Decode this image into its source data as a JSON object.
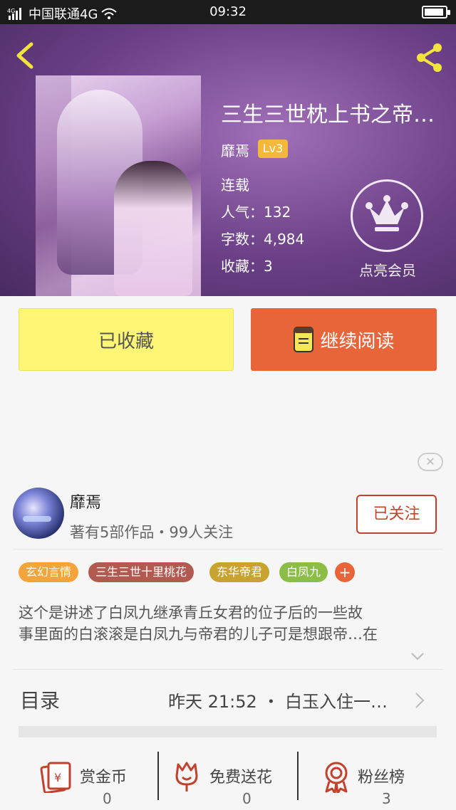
{
  "status_bar": {
    "carrier": "中国联通4G",
    "signal_label": "4G",
    "time": "09:32"
  },
  "book": {
    "title": "三生三世枕上书之帝…",
    "author": "靡焉",
    "level": "Lv3",
    "status": "连载",
    "popularity_label": "人气：",
    "popularity": "132",
    "words_label": "字数：",
    "words": "4,984",
    "favorites_label": "收藏：",
    "favorites": "3",
    "vip_label": "点亮会员"
  },
  "actions": {
    "collected_label": "已收藏",
    "continue_label": "继续阅读"
  },
  "author_card": {
    "name": "靡焉",
    "meta": "著有5部作品・99人关注",
    "follow_label": "已关注"
  },
  "tags": [
    {
      "label": "玄幻言情",
      "color": "#f3a43a"
    },
    {
      "label": "三生三世十里桃花",
      "color": "#b35a50"
    },
    {
      "label": "东华帝君",
      "color": "#c9a330"
    },
    {
      "label": "白凤九",
      "color": "#8cbd47"
    }
  ],
  "tag_plus": "+",
  "description": {
    "line1": "这个是讲述了白凤九继承青丘女君的位子后的一些故",
    "line2": "事里面的白滚滚是白凤九与帝君的儿子可是想跟帝…在"
  },
  "catalog": {
    "label": "目录",
    "update": "昨天 21:52 ・ 白玉入住一…"
  },
  "bottom_bar": [
    {
      "label": "赏金币",
      "count": "0",
      "icon": "reward-envelope-icon"
    },
    {
      "label": "免费送花",
      "count": "0",
      "icon": "flower-icon"
    },
    {
      "label": "粉丝榜",
      "count": "3",
      "icon": "rank-medal-icon"
    }
  ],
  "colors": {
    "accent": "#e8653a",
    "collected_bg": "#fff675",
    "follow": "#c2412d",
    "header": "#6a3f86"
  }
}
